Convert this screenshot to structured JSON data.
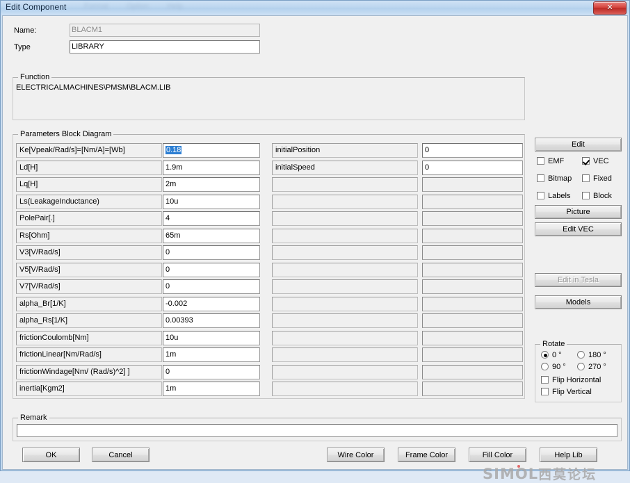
{
  "window": {
    "title": "Edit Component",
    "ghost_menu": [
      "Format",
      "Option",
      "Help"
    ],
    "close_label": "✕"
  },
  "header": {
    "name_label": "Name:",
    "name_value": "BLACM1",
    "type_label": "Type",
    "type_value": "LIBRARY"
  },
  "function": {
    "group_title": "Function",
    "path": "ELECTRICALMACHINES\\PMSM\\BLACM.LIB"
  },
  "parameters": {
    "group_title": "Parameters Block Diagram",
    "left": [
      {
        "label": "Ke[Vpeak/Rad/s]=[Nm/A]=[Wb]",
        "value": "0.18",
        "selected": true
      },
      {
        "label": "Ld[H]",
        "value": "1.9m"
      },
      {
        "label": "Lq[H]",
        "value": "2m"
      },
      {
        "label": "Ls(LeakageInductance)",
        "value": "10u"
      },
      {
        "label": "PolePair[.]",
        "value": "4"
      },
      {
        "label": "Rs[Ohm]",
        "value": "65m"
      },
      {
        "label": "V3[V/Rad/s]",
        "value": "0"
      },
      {
        "label": "V5[V/Rad/s]",
        "value": "0"
      },
      {
        "label": "V7[V/Rad/s]",
        "value": "0"
      },
      {
        "label": "alpha_Br[1/K]",
        "value": "-0.002"
      },
      {
        "label": "alpha_Rs[1/K]",
        "value": "0.00393"
      },
      {
        "label": "frictionCoulomb[Nm]",
        "value": "10u"
      },
      {
        "label": "frictionLinear[Nm/Rad/s]",
        "value": "1m"
      },
      {
        "label": "frictionWindage[Nm/ (Rad/s)^2] ]",
        "value": "0"
      },
      {
        "label": "inertia[Kgm2]",
        "value": "1m"
      }
    ],
    "right": [
      {
        "label": "initialPosition",
        "value": "0"
      },
      {
        "label": "initialSpeed",
        "value": "0"
      },
      {
        "label": "",
        "value": "",
        "disabled": true
      },
      {
        "label": "",
        "value": "",
        "disabled": true
      },
      {
        "label": "",
        "value": "",
        "disabled": true
      },
      {
        "label": "",
        "value": "",
        "disabled": true
      },
      {
        "label": "",
        "value": "",
        "disabled": true
      },
      {
        "label": "",
        "value": "",
        "disabled": true
      },
      {
        "label": "",
        "value": "",
        "disabled": true
      },
      {
        "label": "",
        "value": "",
        "disabled": true
      },
      {
        "label": "",
        "value": "",
        "disabled": true
      },
      {
        "label": "",
        "value": "",
        "disabled": true
      },
      {
        "label": "",
        "value": "",
        "disabled": true
      },
      {
        "label": "",
        "value": "",
        "disabled": true
      },
      {
        "label": "",
        "value": "",
        "disabled": true
      }
    ]
  },
  "side_panel": {
    "edit_button": "Edit",
    "checkboxes": [
      {
        "label": "EMF",
        "checked": false
      },
      {
        "label": "VEC",
        "checked": true
      },
      {
        "label": "Bitmap",
        "checked": false
      },
      {
        "label": "Fixed",
        "checked": false
      },
      {
        "label": "Labels",
        "checked": false
      },
      {
        "label": "Block",
        "checked": false
      }
    ],
    "picture_button": "Picture",
    "edit_vec_button": "Edit VEC",
    "edit_tesla_button": "Edit in Tesla",
    "models_button": "Models"
  },
  "rotate": {
    "group_title": "Rotate",
    "options": [
      {
        "label": "0 °",
        "selected": true
      },
      {
        "label": "180 °",
        "selected": false
      },
      {
        "label": "90 °",
        "selected": false
      },
      {
        "label": "270 °",
        "selected": false
      }
    ],
    "flip_horizontal": "Flip Horizontal",
    "flip_vertical": "Flip Vertical"
  },
  "remark": {
    "group_title": "Remark",
    "value": "",
    "placeholder": ""
  },
  "footer": {
    "ok": "OK",
    "cancel": "Cancel",
    "wire_color": "Wire Color",
    "frame_color": "Frame Color",
    "fill_color": "Fill Color",
    "help_lib": "Help Lib"
  },
  "watermark": {
    "latin": "SIMOL",
    "cjk": "西莫论坛"
  },
  "colors": {
    "selection": "#2d7fd3",
    "dialog_bg": "#f0f0f0",
    "title_bg": "#c2d8ee",
    "close_red": "#d6453f"
  }
}
